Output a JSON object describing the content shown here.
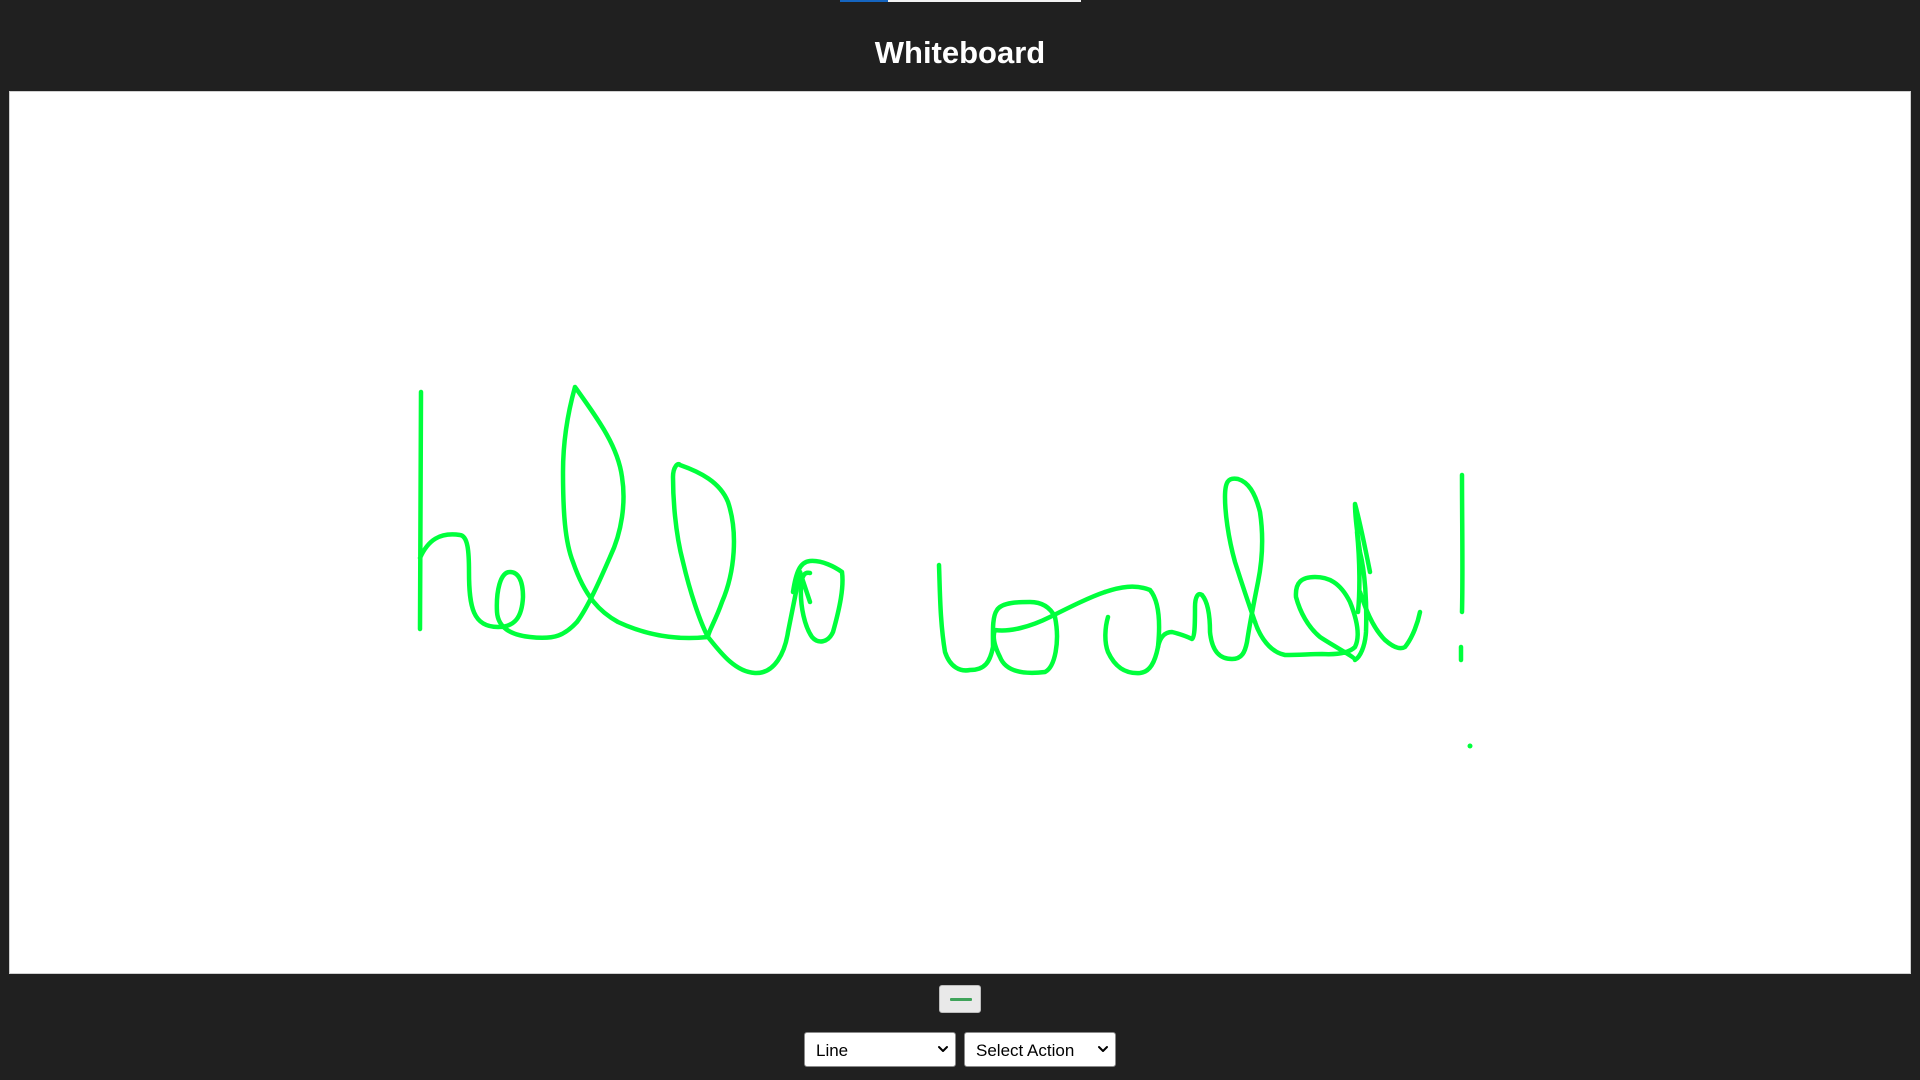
{
  "header": {
    "title": "Whiteboard"
  },
  "canvas": {
    "background": "#ffffff",
    "drawing_color": "#00ff3c",
    "drawn_text": "hello world!"
  },
  "toolbar": {
    "color_button_swatch": "#3fa35a",
    "tool_select": {
      "selected": "Line"
    },
    "action_select": {
      "selected": "Select Action"
    }
  },
  "colors": {
    "page_background": "#202020",
    "title_text": "#ffffff",
    "top_strip": "#f2f2f2",
    "top_strip_accent": "#1565c0"
  }
}
